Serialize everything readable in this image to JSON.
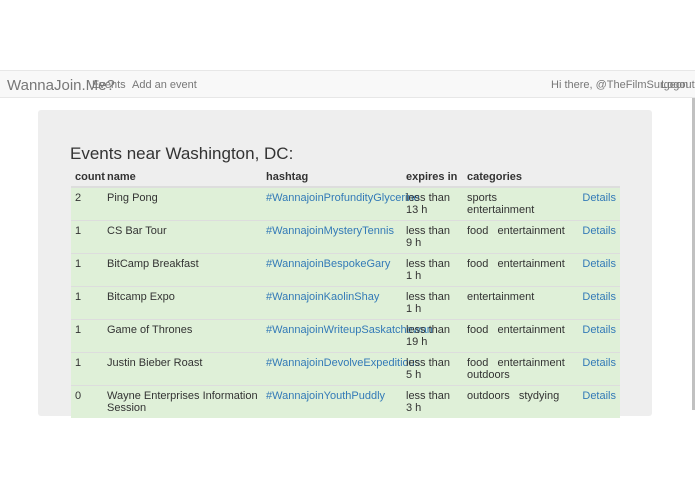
{
  "navbar": {
    "brand": "WannaJoin.Me?",
    "links": [
      "Events",
      "Add an event"
    ],
    "greeting": "Hi there, @TheFilmSurgeon",
    "logout": "Logout"
  },
  "page": {
    "title": "Events near Washington, DC:"
  },
  "table": {
    "headers": [
      "count",
      "name",
      "hashtag",
      "expires in",
      "categories",
      ""
    ],
    "rows": [
      {
        "count": "2",
        "name": "Ping Pong",
        "hashtag": "#WannajoinProfundityGlycerine",
        "expires": "less than 13 h",
        "categories": [
          "sports",
          "entertainment"
        ],
        "details": "Details"
      },
      {
        "count": "1",
        "name": "CS Bar Tour",
        "hashtag": "#WannajoinMysteryTennis",
        "expires": "less than 9 h",
        "categories": [
          "food",
          "entertainment"
        ],
        "details": "Details"
      },
      {
        "count": "1",
        "name": "BitCamp Breakfast",
        "hashtag": "#WannajoinBespokeGary",
        "expires": "less than 1 h",
        "categories": [
          "food",
          "entertainment"
        ],
        "details": "Details"
      },
      {
        "count": "1",
        "name": "Bitcamp Expo",
        "hashtag": "#WannajoinKaolinShay",
        "expires": "less than 1 h",
        "categories": [
          "entertainment"
        ],
        "details": "Details"
      },
      {
        "count": "1",
        "name": "Game of Thrones",
        "hashtag": "#WannajoinWriteupSaskatchewan",
        "expires": "less than 19 h",
        "categories": [
          "food",
          "entertainment"
        ],
        "details": "Details"
      },
      {
        "count": "1",
        "name": "Justin Bieber Roast",
        "hashtag": "#WannajoinDevolveExpeditious",
        "expires": "less than 5 h",
        "categories": [
          "food",
          "entertainment",
          "outdoors"
        ],
        "details": "Details"
      },
      {
        "count": "0",
        "name": "Wayne Enterprises Information Session",
        "hashtag": "#WannajoinYouthPuddly",
        "expires": "less than 3 h",
        "categories": [
          "outdoors",
          "stydying"
        ],
        "details": "Details"
      }
    ]
  },
  "colors": {
    "row_highlight": "#dff0d8",
    "link": "#337ab7",
    "panel": "#eeeeee",
    "navbar": "#f8f8f8"
  }
}
